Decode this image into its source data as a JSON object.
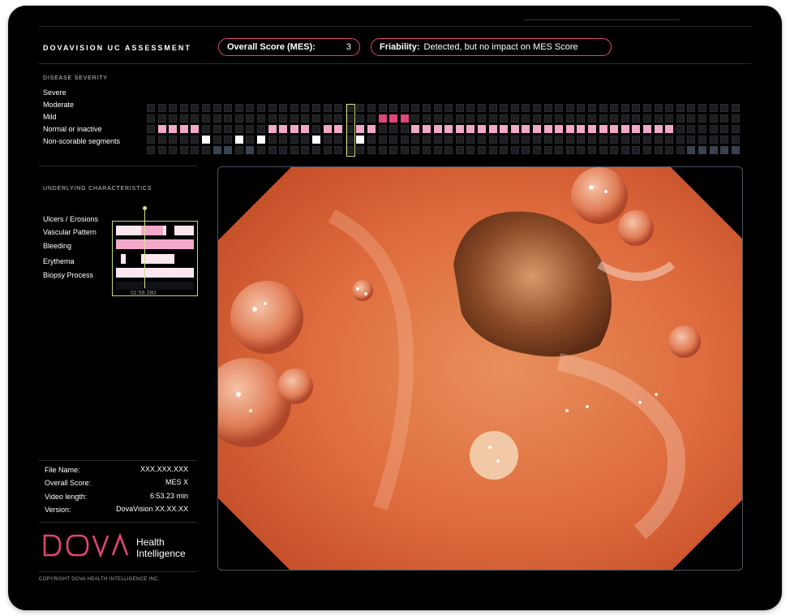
{
  "header": {
    "app_title": "DOVAVISION UC ASSESSMENT",
    "score_pill": {
      "label": "Overall Score (MES):",
      "value": "3"
    },
    "friability_pill": {
      "label": "Friability:",
      "value": "Detected, but no impact on MES Score"
    }
  },
  "severity": {
    "title": "DISEASE SEVERITY",
    "levels": [
      "Severe",
      "Moderate",
      "Mild",
      "Normal or inactive",
      "Non-scorable segments"
    ]
  },
  "characteristics": {
    "title": "UNDERLYING CHARACTERISTICS",
    "items": [
      "Ulcers / Erosions",
      "Vascular Pattern",
      "Bleeding",
      "Erythema",
      "Biopsy Process"
    ],
    "timestamp": "01:59.280"
  },
  "info": {
    "rows": [
      {
        "key": "File Name:",
        "value": "XXX.XXX.XXX"
      },
      {
        "key": "Overall Score:",
        "value": "MES X"
      },
      {
        "key": "Video length:",
        "value": "6:53.23 min"
      },
      {
        "key": "Version:",
        "value": "DovaVision XX.XX.XX"
      }
    ]
  },
  "brand": {
    "logo_text": "DOVA",
    "sub_line1": "Health",
    "sub_line2": "Intelligence",
    "copyright": "COPYRIGHT DOVA HEALTH INTELLIGENCE INC.",
    "accent_color": "#e0457b"
  }
}
